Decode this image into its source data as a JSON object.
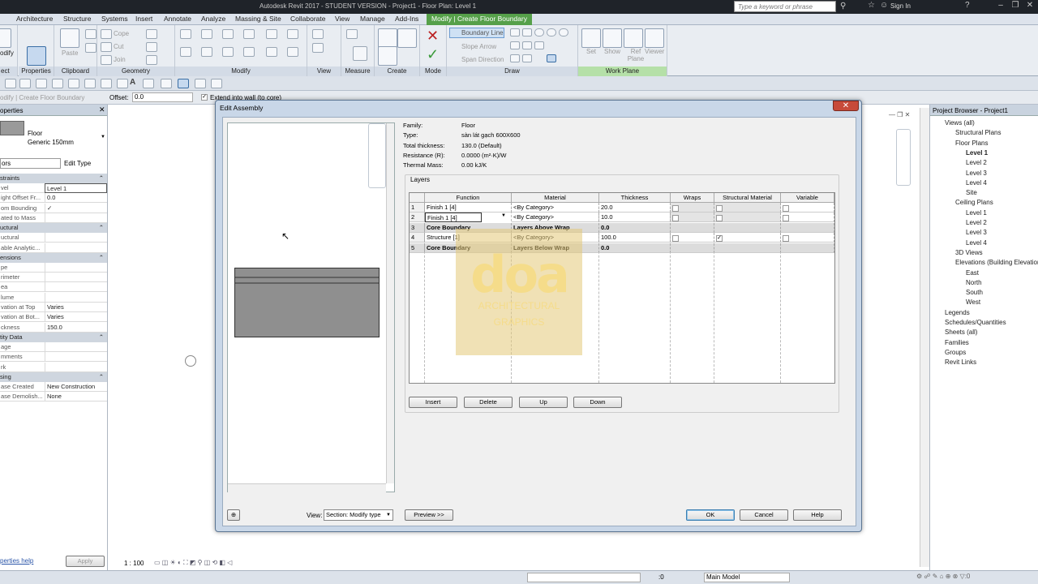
{
  "app": {
    "title": "Autodesk Revit 2017 -  STUDENT VERSION -    Project1 - Floor Plan: Level 1",
    "search_placeholder": "Type a keyword or phrase",
    "sign_in": "Sign In"
  },
  "tabs": [
    "Architecture",
    "Structure",
    "Systems",
    "Insert",
    "Annotate",
    "Analyze",
    "Massing & Site",
    "Collaborate",
    "View",
    "Manage",
    "Add-Ins",
    "Modify | Create Floor Boundary"
  ],
  "ribbon": {
    "panels": [
      "Properties",
      "Clipboard",
      "Geometry",
      "Modify",
      "View",
      "Measure",
      "Create",
      "Mode",
      "Draw",
      "Work Plane"
    ],
    "left_cut_label": "ect",
    "modify_label": "odify",
    "properties_btn": "Properties",
    "paste": "Paste",
    "cope": "Cope",
    "cut": "Cut",
    "join": "Join",
    "boundary_line": "Boundary Line",
    "slope_arrow": "Slope Arrow",
    "span_direction": "Span Direction",
    "set": "Set",
    "show": "Show",
    "ref_plane": "Ref Plane",
    "viewer": "Viewer"
  },
  "options_bar": {
    "context": "odify | Create Floor Boundary",
    "offset_label": "Offset:",
    "offset_value": "0.0",
    "extend_label": "Extend into wall (to core)"
  },
  "properties": {
    "title": "operties",
    "type_name": "Floor",
    "type_sub": "Generic 150mm",
    "selector": "ors",
    "edit_type": "Edit Type",
    "sections": [
      {
        "name": "straints",
        "rows": [
          [
            "vel",
            "Level 1"
          ],
          [
            "ight Offset Fr...",
            "0.0"
          ],
          [
            "om Bounding",
            "✓"
          ],
          [
            "ated to Mass",
            ""
          ]
        ]
      },
      {
        "name": "uctural",
        "rows": [
          [
            "uctural",
            ""
          ],
          [
            "able Analytic...",
            ""
          ]
        ]
      },
      {
        "name": "ensions",
        "rows": [
          [
            "pe",
            ""
          ],
          [
            "rimeter",
            ""
          ],
          [
            "ea",
            ""
          ],
          [
            "lume",
            ""
          ],
          [
            "vation at Top",
            "Varies"
          ],
          [
            "vation at Bot...",
            "Varies"
          ],
          [
            "ckness",
            "150.0"
          ]
        ]
      },
      {
        "name": "tity Data",
        "rows": [
          [
            "age",
            ""
          ],
          [
            "mments",
            ""
          ],
          [
            "rk",
            ""
          ]
        ]
      },
      {
        "name": "sing",
        "rows": [
          [
            "ase Created",
            "New Construction"
          ],
          [
            "ase Demolish...",
            "None"
          ]
        ]
      }
    ],
    "help_link": "perties help",
    "apply": "Apply"
  },
  "status": {
    "scale": "1 : 100",
    "zero": ":0",
    "model": "Main Model"
  },
  "project_browser": {
    "title": "Project Browser - Project1",
    "items": [
      {
        "label": "Views (all)",
        "level": 0,
        "bold": false
      },
      {
        "label": "Structural Plans",
        "level": 1,
        "bold": false
      },
      {
        "label": "Floor Plans",
        "level": 1,
        "bold": false
      },
      {
        "label": "Level 1",
        "level": 2,
        "bold": true
      },
      {
        "label": "Level 2",
        "level": 2,
        "bold": false
      },
      {
        "label": "Level 3",
        "level": 2,
        "bold": false
      },
      {
        "label": "Level 4",
        "level": 2,
        "bold": false
      },
      {
        "label": "Site",
        "level": 2,
        "bold": false
      },
      {
        "label": "Ceiling Plans",
        "level": 1,
        "bold": false
      },
      {
        "label": "Level 1",
        "level": 2,
        "bold": false
      },
      {
        "label": "Level 2",
        "level": 2,
        "bold": false
      },
      {
        "label": "Level 3",
        "level": 2,
        "bold": false
      },
      {
        "label": "Level 4",
        "level": 2,
        "bold": false
      },
      {
        "label": "3D Views",
        "level": 1,
        "bold": false
      },
      {
        "label": "Elevations (Building Elevation)",
        "level": 1,
        "bold": false
      },
      {
        "label": "East",
        "level": 2,
        "bold": false
      },
      {
        "label": "North",
        "level": 2,
        "bold": false
      },
      {
        "label": "South",
        "level": 2,
        "bold": false
      },
      {
        "label": "West",
        "level": 2,
        "bold": false
      },
      {
        "label": "Legends",
        "level": 0,
        "bold": false
      },
      {
        "label": "Schedules/Quantities",
        "level": 0,
        "bold": false
      },
      {
        "label": "Sheets (all)",
        "level": 0,
        "bold": false
      },
      {
        "label": "Families",
        "level": 0,
        "bold": false
      },
      {
        "label": "Groups",
        "level": 0,
        "bold": false
      },
      {
        "label": "Revit Links",
        "level": 0,
        "bold": false
      }
    ]
  },
  "dialog": {
    "title": "Edit Assembly",
    "info": [
      [
        "Family:",
        "Floor"
      ],
      [
        "Type:",
        "sàn lát gạch 600X600"
      ],
      [
        "Total thickness:",
        "130.0 (Default)"
      ],
      [
        "Resistance (R):",
        "0.0000 (m²·K)/W"
      ],
      [
        "Thermal Mass:",
        "0.00 kJ/K"
      ]
    ],
    "layers_label": "Layers",
    "columns": [
      "Function",
      "Material",
      "Thickness",
      "Wraps",
      "Structural Material",
      "Variable"
    ],
    "rows": [
      {
        "n": "1",
        "function": "Finish 1 [4]",
        "material": "<By Category>",
        "thickness": "20.0",
        "wraps": false,
        "structural": false,
        "variable": false,
        "core": false
      },
      {
        "n": "2",
        "function": "Finish 1 [4]",
        "material": "<By Category>",
        "thickness": "10.0",
        "wraps": false,
        "structural": false,
        "variable": false,
        "core": false
      },
      {
        "n": "3",
        "function": "Core Boundary",
        "material": "Layers Above Wrap",
        "thickness": "0.0",
        "core": true
      },
      {
        "n": "4",
        "function": "Structure [1]",
        "material": "<By Category>",
        "thickness": "100.0",
        "wraps": false,
        "structural": true,
        "variable": false,
        "core": false
      },
      {
        "n": "5",
        "function": "Core Boundary",
        "material": "Layers Below Wrap",
        "thickness": "0.0",
        "core": true
      }
    ],
    "buttons": {
      "insert": "Insert",
      "delete": "Delete",
      "up": "Up",
      "down": "Down",
      "ok": "OK",
      "cancel": "Cancel",
      "help": "Help",
      "preview": "Preview >>"
    },
    "view_label": "View:",
    "view_value": "Section: Modify type"
  },
  "watermark": {
    "big": "doa",
    "line1": "ARCHITECTURAL",
    "line2": "GRAPHICS"
  }
}
